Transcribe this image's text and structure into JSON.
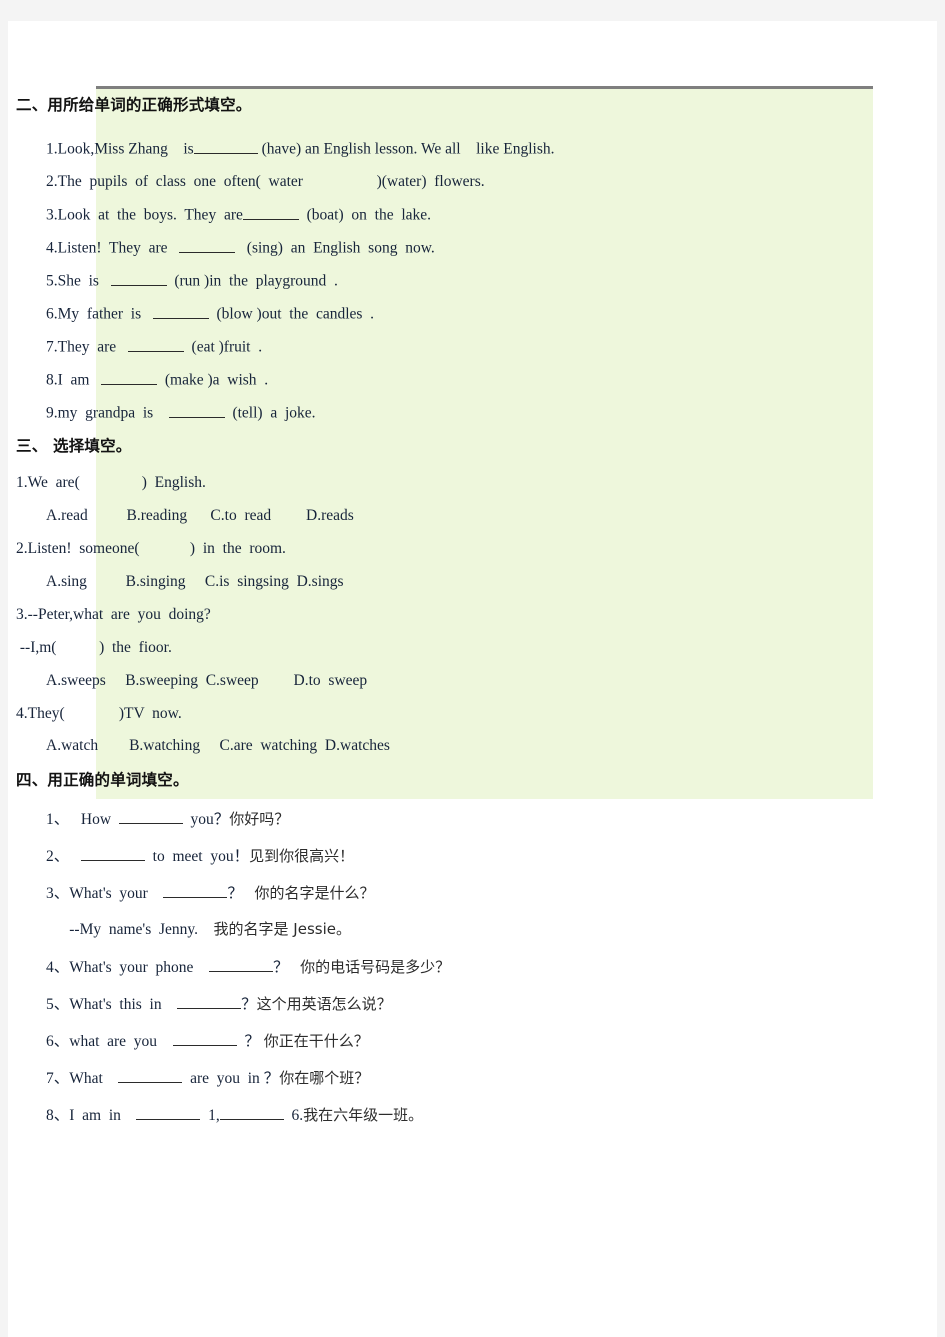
{
  "document": {
    "page_background": "#ffffff",
    "outer_background": "#f4f4f4",
    "highlight_color": "#eef7dc",
    "rule_color": "#7f7f7f",
    "text_color": "#17243a"
  },
  "section2": {
    "heading": "二、用所给单词的正确形式填空。",
    "items": [
      {
        "pre": "1.Look,Miss Zhang    is",
        "blank": "b-lg",
        "post": " (have) an English lesson. We all    like English."
      },
      {
        "pre": "2.The  pupils  of  class  one  often(  water",
        "blank": "none",
        "post": "                   )(water)  flowers."
      },
      {
        "pre": "3.Look  at  the  boys.  They  are",
        "blank": "b-md",
        "post": "  (boat)  on  the  lake."
      },
      {
        "pre": "4.Listen!  They  are   ",
        "blank": "b-md",
        "post": "   (sing)  an  English  song  now."
      },
      {
        "pre": "5.She  is   ",
        "blank": "b-md",
        "post": "  (run )in  the  playground  ."
      },
      {
        "pre": "6.My  father  is   ",
        "blank": "b-md",
        "post": "  (blow )out  the  candles  ."
      },
      {
        "pre": "7.They  are   ",
        "blank": "b-md",
        "post": "  (eat )fruit  ."
      },
      {
        "pre": "8.I  am   ",
        "blank": "b-md",
        "post": "  (make )a  wish  ."
      },
      {
        "pre": "9.my  grandpa  is    ",
        "blank": "b-md",
        "post": "  (tell)  a  joke."
      }
    ]
  },
  "section3": {
    "heading": "三、 选择填空。",
    "questions": [
      {
        "stem": "1.We  are(                )  English.",
        "options": "A.read          B.reading      C.to  read         D.reads"
      },
      {
        "stem": "2.Listen!  someone(             )  in  the  room.",
        "options": "A.sing          B.singing     C.is  singsing  D.sings"
      },
      {
        "stem": "3.--Peter,what  are  you  doing?",
        "options": ""
      },
      {
        "stem": " --I,m(           )  the  fioor.",
        "options": "A.sweeps     B.sweeping  C.sweep         D.to  sweep"
      },
      {
        "stem": "4.They(              )TV  now.",
        "options": "A.watch        B.watching     C.are  watching  D.watches"
      }
    ]
  },
  "section4": {
    "heading": "四、用正确的单词填空。",
    "items": [
      {
        "pre": "1、   How  ",
        "blank": "b-lg",
        "post": "  you？",
        "cn": "你好吗？"
      },
      {
        "pre": "2、   ",
        "blank": "b-lg",
        "post": "  to  meet  you！",
        "cn": "见到你很高兴！"
      },
      {
        "pre": "3、What's  your    ",
        "blank": "b-lg",
        "post": "？   ",
        "cn": "你的名字是什么？"
      },
      {
        "pre": "      --My  name's  Jenny.    ",
        "blank": "none",
        "post": "",
        "cn": "我的名字是 Jessie。"
      },
      {
        "pre": "4、What's  your  phone    ",
        "blank": "b-lg",
        "post": "？   ",
        "cn": "你的电话号码是多少？"
      },
      {
        "pre": "5、What's  this  in    ",
        "blank": "b-lg",
        "post": "？",
        "cn": "这个用英语怎么说？"
      },
      {
        "pre": "6、what  are  you    ",
        "blank": "b-lg",
        "post": "  ？ ",
        "cn": "你正在干什么？"
      },
      {
        "pre": "7、What    ",
        "blank": "b-lg",
        "post": "  are  you  in ？",
        "cn": "你在哪个班？"
      },
      {
        "pre": "8、I  am  in    ",
        "blank": "b-lg",
        "post": "  1,",
        "blank2": "b-lg",
        "post2": "  6.",
        "cn": "我在六年级一班。"
      }
    ]
  }
}
